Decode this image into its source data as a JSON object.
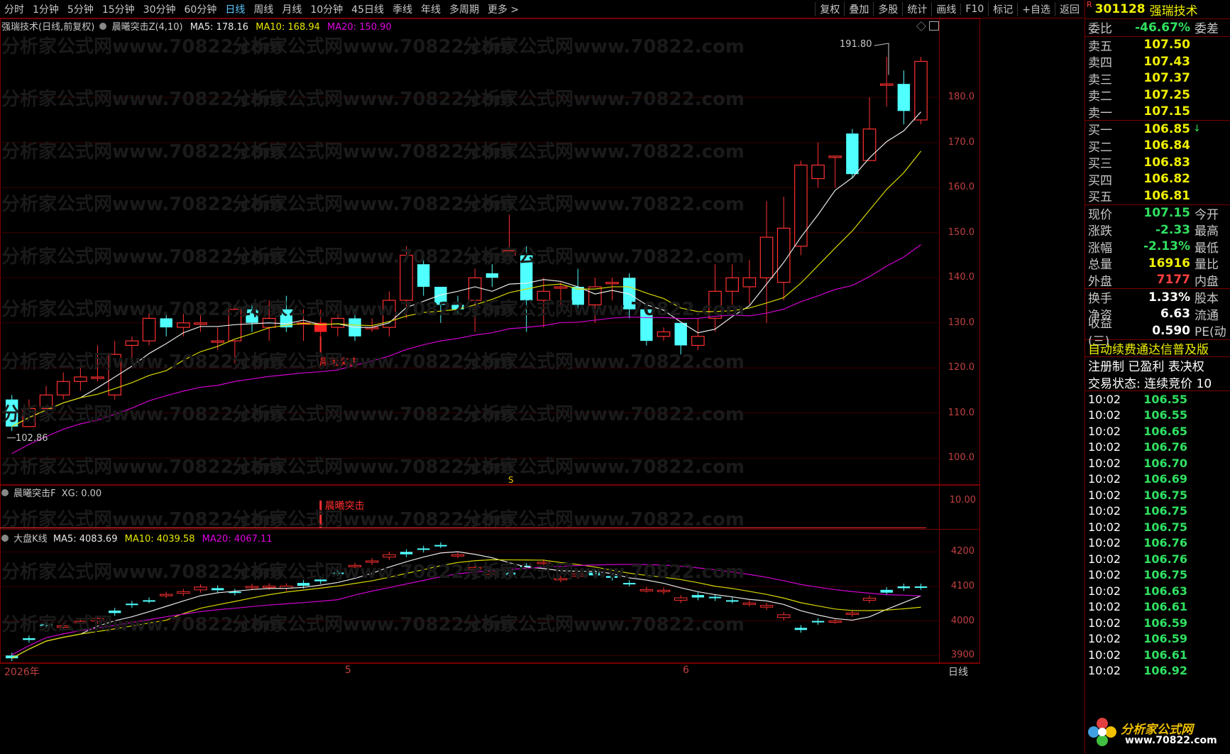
{
  "toolbar": {
    "periods": [
      "分时",
      "1分钟",
      "5分钟",
      "15分钟",
      "30分钟",
      "60分钟",
      "日线",
      "周线",
      "月线",
      "10分钟",
      "45日线",
      "季线",
      "年线",
      "多周期",
      "更多 >"
    ],
    "active_period": "日线",
    "tools": [
      "复权",
      "叠加",
      "多股",
      "统计",
      "画线",
      "F10",
      "标记",
      "+自选",
      "返回"
    ]
  },
  "main_chart": {
    "legend": {
      "title": "强瑞技术(日线,前复权)",
      "indicator": "晨曦突击Z(4,10)",
      "ma5": "MA5: 178.16",
      "ma10": "MA10: 168.94",
      "ma20": "MA20: 150.90"
    },
    "high_label": "191.80",
    "low_label": "102.86",
    "signal_label": "晨曦突击",
    "s_marker": "S",
    "y_ticks": [
      "180.0",
      "170.0",
      "160.0",
      "150.0",
      "140.0",
      "130.0",
      "120.0",
      "110.0",
      "100.0"
    ]
  },
  "sub1": {
    "legend_name": "晨曦突击F",
    "legend_val": "XG: 0.00",
    "signal_label": "晨曦突击",
    "y_tick": "10.00"
  },
  "sub2": {
    "legend_name": "大盘K线",
    "ma5": "MA5: 4083.69",
    "ma10": "MA10: 4039.58",
    "ma20": "MA20: 4067.11",
    "y_ticks": [
      "4200",
      "4100",
      "4000",
      "3900"
    ]
  },
  "xaxis": {
    "labels": [
      "2026年",
      "5",
      "6"
    ],
    "period_tab": "日线"
  },
  "watermark": "分析家公式网www.70822.com",
  "right_panel": {
    "code": "301128",
    "name": "强瑞技术",
    "r_mark": "R",
    "weibi": {
      "label": "委比",
      "value": "-46.67%",
      "extra": "委差"
    },
    "sells": [
      {
        "label": "卖五",
        "price": "107.50"
      },
      {
        "label": "卖四",
        "price": "107.43"
      },
      {
        "label": "卖三",
        "price": "107.37"
      },
      {
        "label": "卖二",
        "price": "107.25"
      },
      {
        "label": "卖一",
        "price": "107.15"
      }
    ],
    "buys": [
      {
        "label": "买一",
        "price": "106.85"
      },
      {
        "label": "买二",
        "price": "106.84"
      },
      {
        "label": "买三",
        "price": "106.83"
      },
      {
        "label": "买四",
        "price": "106.82"
      },
      {
        "label": "买五",
        "price": "106.81"
      }
    ],
    "quotes": [
      {
        "label": "现价",
        "value": "107.15",
        "extra": "今开"
      },
      {
        "label": "涨跌",
        "value": "-2.33",
        "extra": "最高"
      },
      {
        "label": "涨幅",
        "value": "-2.13%",
        "extra": "最低"
      },
      {
        "label": "总量",
        "value": "16916",
        "extra": "量比"
      },
      {
        "label": "外盘",
        "value": "7177",
        "extra": "内盘"
      }
    ],
    "stats": [
      {
        "label": "换手",
        "value": "1.33%",
        "extra": "股本"
      },
      {
        "label": "净资",
        "value": "6.63",
        "extra": "流通"
      },
      {
        "label": "收益(三)",
        "value": "0.590",
        "extra": "PE(动"
      }
    ],
    "info1": "自动续费通达信普及版",
    "info2": "注册制 已盈利 表决权",
    "info3": "交易状态: 连续竞价 10",
    "ticks": [
      {
        "t": "10:02",
        "p": "106.55"
      },
      {
        "t": "10:02",
        "p": "106.55"
      },
      {
        "t": "10:02",
        "p": "106.65"
      },
      {
        "t": "10:02",
        "p": "106.76"
      },
      {
        "t": "10:02",
        "p": "106.70"
      },
      {
        "t": "10:02",
        "p": "106.69"
      },
      {
        "t": "10:02",
        "p": "106.75"
      },
      {
        "t": "10:02",
        "p": "106.75"
      },
      {
        "t": "10:02",
        "p": "106.75"
      },
      {
        "t": "10:02",
        "p": "106.76"
      },
      {
        "t": "10:02",
        "p": "106.76"
      },
      {
        "t": "10:02",
        "p": "106.75"
      },
      {
        "t": "10:02",
        "p": "106.63"
      },
      {
        "t": "10:02",
        "p": "106.61"
      },
      {
        "t": "10:02",
        "p": "106.59"
      },
      {
        "t": "10:02",
        "p": "106.59"
      },
      {
        "t": "10:02",
        "p": "106.61"
      },
      {
        "t": "10:02",
        "p": "106.92"
      }
    ],
    "logo_text": "分析家公式网",
    "logo_url": "www.70822.com"
  },
  "chart_data": {
    "type": "candlestick",
    "ylim": [
      95,
      195
    ],
    "candles": [
      [
        113,
        107,
        114,
        106
      ],
      [
        107,
        111,
        113,
        107
      ],
      [
        111,
        114,
        116,
        110
      ],
      [
        114,
        117,
        119,
        113
      ],
      [
        117,
        118,
        121,
        115
      ],
      [
        118,
        118,
        125,
        117
      ],
      [
        114,
        123,
        126,
        113
      ],
      [
        125,
        126,
        127,
        122
      ],
      [
        126,
        131,
        134,
        125
      ],
      [
        131,
        129,
        132,
        127
      ],
      [
        129,
        130,
        132,
        127
      ],
      [
        130,
        130,
        132,
        128
      ],
      [
        126,
        126,
        129,
        124
      ],
      [
        126,
        133,
        134,
        121
      ],
      [
        133,
        130,
        134,
        128
      ],
      [
        129,
        131,
        135,
        126
      ],
      [
        133,
        129,
        136,
        128
      ],
      [
        130,
        130,
        133,
        126
      ],
      [
        130,
        128,
        133,
        124
      ],
      [
        129,
        131,
        132,
        127
      ],
      [
        131,
        127,
        133,
        126
      ],
      [
        129,
        129,
        131,
        128
      ],
      [
        129,
        135,
        137,
        127
      ],
      [
        135,
        145,
        147,
        131
      ],
      [
        143,
        138,
        144,
        136
      ],
      [
        138,
        134,
        138,
        130
      ],
      [
        134,
        133,
        136,
        132
      ],
      [
        135,
        140,
        142,
        128
      ],
      [
        141,
        140,
        143,
        138
      ],
      [
        145,
        146,
        154,
        144
      ],
      [
        145,
        135,
        147,
        128
      ],
      [
        135,
        137,
        140,
        129
      ],
      [
        138,
        138,
        139,
        134
      ],
      [
        138,
        134,
        142,
        132
      ],
      [
        134,
        138,
        140,
        130
      ],
      [
        139,
        139,
        140,
        135
      ],
      [
        140,
        133,
        141,
        131
      ],
      [
        133,
        126,
        134,
        125
      ],
      [
        127,
        128,
        129,
        126
      ],
      [
        130,
        125,
        130,
        123
      ],
      [
        125,
        127,
        131,
        124
      ],
      [
        131,
        137,
        143,
        128
      ],
      [
        137,
        140,
        143,
        134
      ],
      [
        138,
        140,
        144,
        134
      ],
      [
        140,
        149,
        157,
        130
      ],
      [
        139,
        151,
        158,
        135
      ],
      [
        147,
        165,
        166,
        145
      ],
      [
        162,
        165,
        170,
        160
      ],
      [
        167,
        167,
        167,
        160
      ],
      [
        172,
        163,
        173,
        162
      ],
      [
        166,
        173,
        180,
        166
      ],
      [
        183,
        183,
        189,
        178
      ],
      [
        183,
        177,
        186,
        174
      ],
      [
        175,
        188,
        189,
        174
      ]
    ],
    "signal_index": 18
  }
}
